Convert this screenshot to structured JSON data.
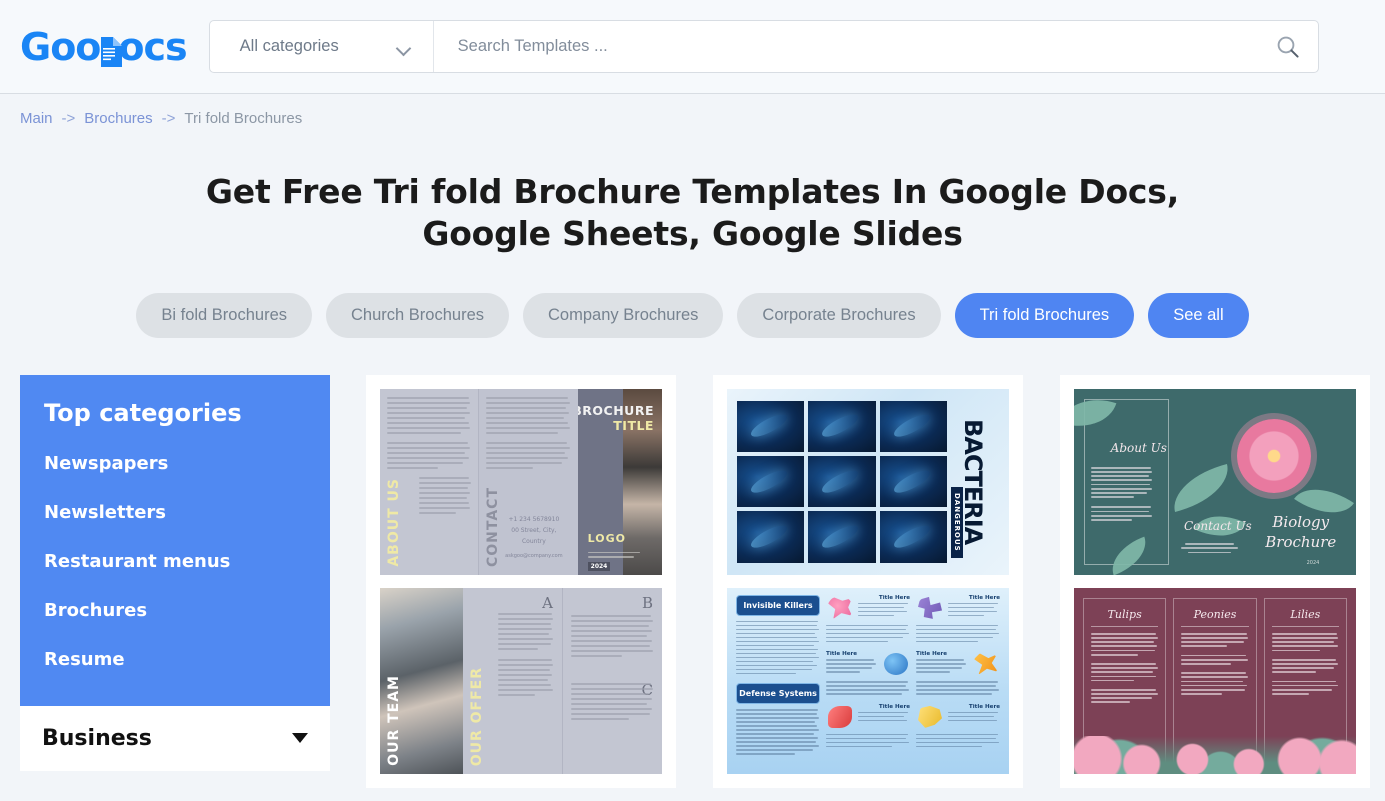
{
  "header": {
    "logo": {
      "part1": "Goo",
      "part2": "ocs",
      "icon": "document-icon"
    },
    "category_select": {
      "value": "All categories",
      "icon": "chevron-down-icon"
    },
    "search": {
      "placeholder": "Search Templates ...",
      "value": "",
      "icon": "search-icon"
    }
  },
  "breadcrumb": {
    "items": [
      {
        "label": "Main",
        "link": true
      },
      {
        "label": "Brochures",
        "link": true
      },
      {
        "label": "Tri fold Brochures",
        "link": false
      }
    ],
    "separator": "->"
  },
  "page": {
    "title": "Get Free Tri fold Brochure Templates In Google Docs, Google Sheets, Google Slides"
  },
  "chips": [
    {
      "label": "Bi fold Brochures",
      "active": false
    },
    {
      "label": "Church Brochures",
      "active": false
    },
    {
      "label": "Company Brochures",
      "active": false
    },
    {
      "label": "Corporate Brochures",
      "active": false
    },
    {
      "label": "Tri fold Brochures",
      "active": true
    },
    {
      "label": "See all",
      "active": true
    }
  ],
  "sidebar": {
    "title": "Top categories",
    "items": [
      {
        "label": "Newspapers"
      },
      {
        "label": "Newsletters"
      },
      {
        "label": "Restaurant menus"
      },
      {
        "label": "Brochures"
      },
      {
        "label": "Resume"
      }
    ],
    "accordion": {
      "label": "Business",
      "icon": "caret-down-icon"
    }
  },
  "templates": [
    {
      "name": "corporate-grey-trifold",
      "front": {
        "title_line1": "BROCHURE",
        "title_line2": "TITLE",
        "panel_about": "ABOUT US",
        "panel_contact": "CONTACT",
        "logo": "LOGO",
        "contact_phone": "+1 234 5678910",
        "contact_address": "00 Street, City,",
        "contact_country": "Country",
        "contact_email": "askgoo@company.com",
        "year": "2024"
      },
      "back": {
        "panel_team": "OUR TEAM",
        "panel_offer": "OUR OFFER",
        "label_a": "A",
        "label_b": "B",
        "label_c": "C"
      }
    },
    {
      "name": "dangerous-bacteria",
      "front": {
        "title": "BACTERIA",
        "badge": "DANGEROUS"
      },
      "back": {
        "section1": "Invisible Killers",
        "section2": "Defense Systems",
        "item_title": "Title Here",
        "items": [
          {
            "title": "Title Here",
            "germ": "pink"
          },
          {
            "title": "Title Here",
            "germ": "purple"
          },
          {
            "title": "Title Here",
            "germ": "blue"
          },
          {
            "title": "Title Here",
            "germ": "orange"
          },
          {
            "title": "Title Here",
            "germ": "red"
          },
          {
            "title": "Title Here",
            "germ": "yellow"
          }
        ]
      }
    },
    {
      "name": "biology-floral",
      "front": {
        "about": "About Us",
        "contact": "Contact Us",
        "brand_line1": "Biology",
        "brand_line2": "Brochure",
        "year": "2024"
      },
      "back": {
        "columns": [
          {
            "title": "Tulips"
          },
          {
            "title": "Peonies"
          },
          {
            "title": "Lilies"
          }
        ]
      }
    }
  ],
  "colors": {
    "brand_blue": "#1a85f5",
    "accent_blue": "#5089f2",
    "chip_grey": "#dde1e5",
    "page_bg": "#f2f5f9",
    "text_dark": "#1b1b1b"
  }
}
